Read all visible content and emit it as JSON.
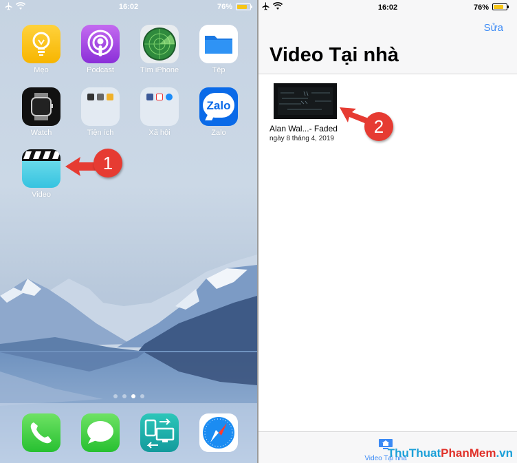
{
  "home": {
    "status": {
      "time": "16:02",
      "battery": "76%"
    },
    "apps": [
      {
        "id": "meo",
        "label": "Mẹo"
      },
      {
        "id": "podcast",
        "label": "Podcast"
      },
      {
        "id": "find-iphone",
        "label": "Tìm iPhone"
      },
      {
        "id": "files",
        "label": "Tệp"
      },
      {
        "id": "watch",
        "label": "Watch"
      },
      {
        "id": "utilities",
        "label": "Tiện ích"
      },
      {
        "id": "social",
        "label": "Xã hội"
      },
      {
        "id": "zalo",
        "label": "Zalo",
        "icon_text": "Zalo"
      },
      {
        "id": "video",
        "label": "Video"
      }
    ],
    "page_dots": {
      "count": 4,
      "active_index": 2
    },
    "dock": [
      {
        "id": "phone",
        "icon": "phone-icon"
      },
      {
        "id": "messages",
        "icon": "messages-icon"
      },
      {
        "id": "transfer",
        "icon": "transfer-icon"
      },
      {
        "id": "safari",
        "icon": "compass-icon"
      }
    ],
    "callout_1": "1"
  },
  "video_app": {
    "status": {
      "time": "16:02",
      "battery": "76%"
    },
    "edit_label": "Sửa",
    "title": "Video Tại nhà",
    "items": [
      {
        "name": "Alan Wal...- Faded",
        "date": "ngày 8 tháng 4, 2019"
      }
    ],
    "tab_label": "Video Tại nhà",
    "callout_2": "2"
  },
  "watermark": {
    "part1": "ThuThuat",
    "part2": "PhanMem",
    "part3": ".vn"
  },
  "colors": {
    "accent": "#3b8af5",
    "callout": "#e63b32",
    "battery_fill": "#f5c518"
  }
}
